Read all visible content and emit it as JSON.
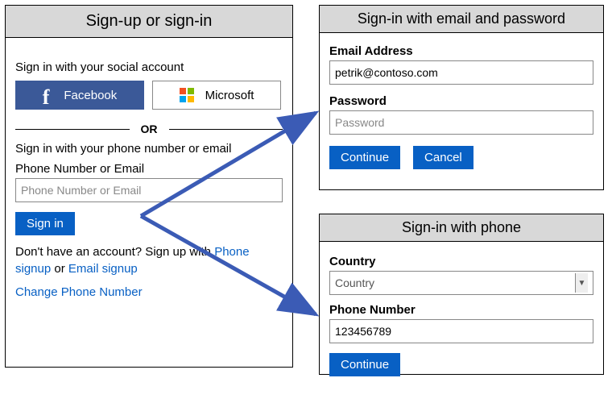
{
  "left": {
    "title": "Sign-up or sign-in",
    "social_heading": "Sign in with your social account",
    "facebook_label": "Facebook",
    "microsoft_label": "Microsoft",
    "or_label": "OR",
    "phone_email_heading": "Sign in with your phone number or email",
    "phone_email_label": "Phone Number or Email",
    "phone_email_placeholder": "Phone Number or Email",
    "signin_label": "Sign in",
    "signup_prefix": "Don't have an account? Sign up with ",
    "signup_phone_link": "Phone signup",
    "signup_mid": " or ",
    "signup_email_link": "Email signup",
    "change_phone_link": "Change Phone Number"
  },
  "email_panel": {
    "title": "Sign-in with email and password",
    "email_label": "Email Address",
    "email_value": "petrik@contoso.com",
    "password_label": "Password",
    "password_placeholder": "Password",
    "continue_label": "Continue",
    "cancel_label": "Cancel"
  },
  "phone_panel": {
    "title": "Sign-in with phone",
    "country_label": "Country",
    "country_selected": "Country",
    "phone_label": "Phone Number",
    "phone_value": "123456789",
    "continue_label": "Continue"
  }
}
